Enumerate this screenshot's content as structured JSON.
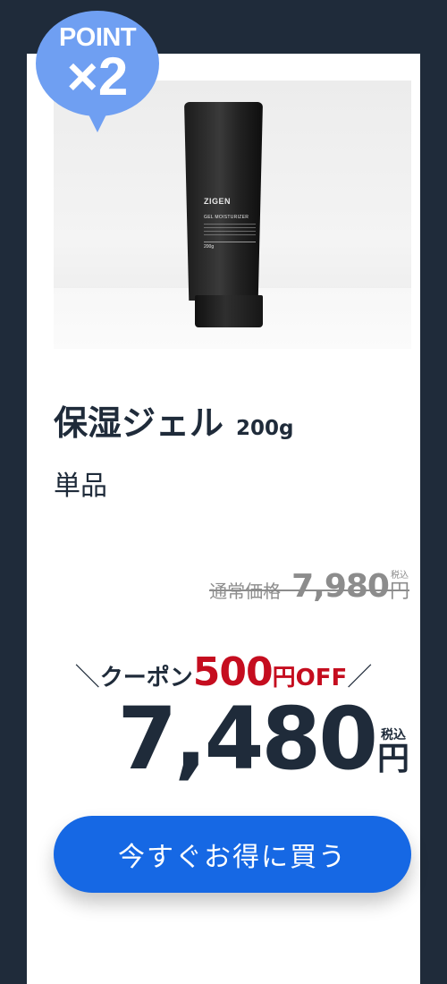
{
  "badge": {
    "label": "POINT",
    "multiplier": "×2"
  },
  "product": {
    "image_alt": "ZIGEN gel moisturizer tube",
    "tube_brand": "ZIGEN",
    "tube_subtitle": "GEL MOISTURIZER",
    "tube_weight": "200g",
    "name": "保湿ジェル",
    "size": "200g",
    "variant": "単品"
  },
  "pricing": {
    "regular_label": "通常価格",
    "regular_value": "7,980",
    "tax_label": "税込",
    "yen": "円",
    "coupon_prefix": "＼",
    "coupon_text": "クーポン",
    "coupon_amount": "500",
    "coupon_unit_off": "円OFF",
    "coupon_suffix": "／",
    "sale_value": "7,480"
  },
  "cta": {
    "label": "今すぐお得に買う"
  },
  "colors": {
    "page_bg": "#1f2b3a",
    "badge": "#6f9ff2",
    "coupon_red": "#c50d1f",
    "button_blue": "#1668e4"
  }
}
